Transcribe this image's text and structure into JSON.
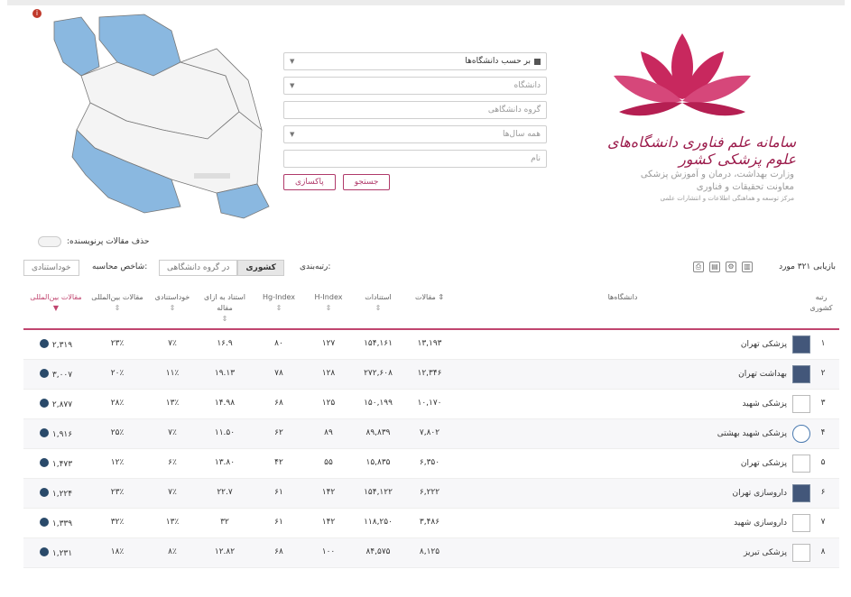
{
  "header": {
    "info_icon": "info-icon"
  },
  "logo": {
    "text": "سامانه علم فناوری دانشگاه‌های علوم پزشکی کشور",
    "ministry_line1": "وزارت بهداشت، درمان و آموزش پزشکی",
    "ministry_line2": "معاونت تحقیقات و فناوری",
    "ministry_line3": "مرکز توسعه و هماهنگی اطلاعات و انتشارات علمی"
  },
  "form": {
    "type_select": "بر حسب دانشگاه‌ها",
    "university_placeholder": "دانشگاه",
    "group_placeholder": "گروه دانشگاهی",
    "year_select": "همه سال‌ها",
    "name_placeholder": "نام",
    "search_button": "جستجو",
    "clear_button": "پاکسازی"
  },
  "toggle": {
    "label": "حذف مقالات پرنویسنده:"
  },
  "toolbar": {
    "results": "بازیابی ۳۲۱ مورد",
    "rank_label": "رتبه‌بندی:",
    "seg_national": "کشوری",
    "seg_group": "در گروه دانشگاهی",
    "calc_label": "شاخص محاسبه:",
    "calc_value": "خوداستنادی"
  },
  "table": {
    "headers": {
      "rank": "رتبه",
      "rank_sub": "کشوری",
      "university": "دانشگاه‌ها",
      "articles": "مقالات",
      "citations": "استنادات",
      "h_index": "H-Index",
      "hg_index": "Hg-Index",
      "cite_per_article": "استناد به ازای مقاله",
      "self_citation": "خوداستنادی",
      "intl_articles": "مقالات بین‌المللی",
      "intl_articles2": "مقالات بین‌المللی"
    },
    "rows": [
      {
        "rank": "۱",
        "name": "پزشکی تهران",
        "articles": "۱۳,۱۹۳",
        "citations": "۱۵۴,۱۶۱",
        "h": "۱۲۷",
        "hg": "۸۰",
        "cpa": "۱۶.۹",
        "self": "۷٪",
        "intl": "۲۳٪",
        "intl2": "۲,۳۱۹",
        "emblem": "dark"
      },
      {
        "rank": "۲",
        "name": "بهداشت تهران",
        "articles": "۱۲,۳۴۶",
        "citations": "۲۷۲,۶۰۸",
        "h": "۱۲۸",
        "hg": "۷۸",
        "cpa": "۱۹.۱۳",
        "self": "۱۱٪",
        "intl": "۲۰٪",
        "intl2": "۳,۰۰۷",
        "emblem": "dark"
      },
      {
        "rank": "۳",
        "name": "پزشکی شهید",
        "articles": "۱۰,۱۷۰",
        "citations": "۱۵۰,۱۹۹",
        "h": "۱۲۵",
        "hg": "۶۸",
        "cpa": "۱۴.۹۸",
        "self": "۱۳٪",
        "intl": "۲۸٪",
        "intl2": "۲,۸۷۷",
        "emblem": "light"
      },
      {
        "rank": "۴",
        "name": "پزشکی شهید بهشتی",
        "articles": "۷,۸۰۲",
        "citations": "۸۹,۸۳۹",
        "h": "۸۹",
        "hg": "۶۲",
        "cpa": "۱۱.۵۰",
        "self": "۷٪",
        "intl": "۲۵٪",
        "intl2": "۱,۹۱۶",
        "emblem": "blue"
      },
      {
        "rank": "۵",
        "name": "پزشکی تهران",
        "articles": "۶,۳۵۰",
        "citations": "۱۵,۸۳۵",
        "h": "۵۵",
        "hg": "۴۲",
        "cpa": "۱۳.۸۰",
        "self": "۶٪",
        "intl": "۱۲٪",
        "intl2": "۱,۴۷۳",
        "emblem": "flag"
      },
      {
        "rank": "۶",
        "name": "داروسازی تهران",
        "articles": "۶,۲۲۲",
        "citations": "۱۵۴,۱۲۲",
        "h": "۱۴۲",
        "hg": "۶۱",
        "cpa": "۲۲.۷",
        "self": "۷٪",
        "intl": "۲۳٪",
        "intl2": "۱,۲۲۴",
        "emblem": "dark"
      },
      {
        "rank": "۷",
        "name": "داروسازی شهید",
        "articles": "۳,۴۸۶",
        "citations": "۱۱۸,۲۵۰",
        "h": "۱۴۲",
        "hg": "۶۱",
        "cpa": "۳۲",
        "self": "۱۳٪",
        "intl": "۳۲٪",
        "intl2": "۱,۳۳۹",
        "emblem": "light"
      },
      {
        "rank": "۸",
        "name": "پزشکی تبریز",
        "articles": "۸,۱۲۵",
        "citations": "۸۴,۵۷۵",
        "h": "۱۰۰",
        "hg": "۶۸",
        "cpa": "۱۲.۸۲",
        "self": "۸٪",
        "intl": "۱۸٪",
        "intl2": "۱,۲۳۱",
        "emblem": "light"
      }
    ]
  },
  "colors": {
    "accent": "#c0456f",
    "brand": "#9b1b4b",
    "map_fill": "#8ab8e0"
  }
}
